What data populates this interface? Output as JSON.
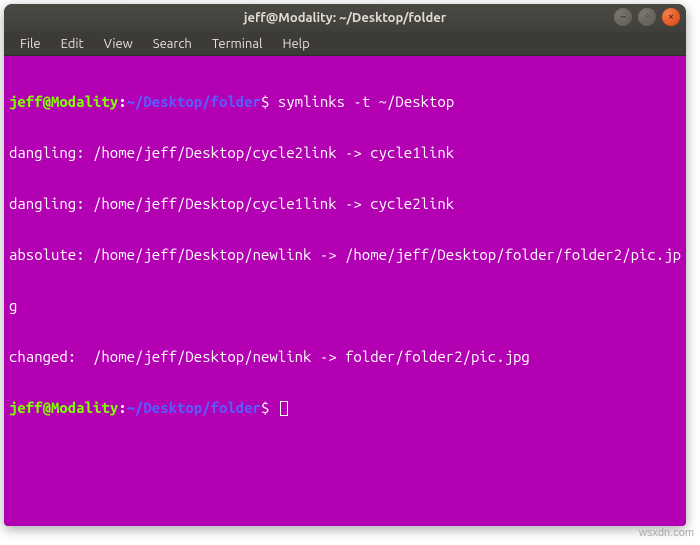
{
  "window": {
    "title": "jeff@Modality: ~/Desktop/folder"
  },
  "menubar": {
    "items": [
      {
        "label": "File"
      },
      {
        "label": "Edit"
      },
      {
        "label": "View"
      },
      {
        "label": "Search"
      },
      {
        "label": "Terminal"
      },
      {
        "label": "Help"
      }
    ]
  },
  "prompt1": {
    "user_host": "jeff@Modality",
    "colon": ":",
    "path": "~/Desktop/folder",
    "dollar": "$ ",
    "command": "symlinks -t ~/Desktop"
  },
  "output": {
    "l1": "dangling: /home/jeff/Desktop/cycle2link -> cycle1link",
    "l2": "dangling: /home/jeff/Desktop/cycle1link -> cycle2link",
    "l3": "absolute: /home/jeff/Desktop/newlink -> /home/jeff/Desktop/folder/folder2/pic.jp",
    "l4": "g",
    "l5": "changed:  /home/jeff/Desktop/newlink -> folder/folder2/pic.jpg"
  },
  "prompt2": {
    "user_host": "jeff@Modality",
    "colon": ":",
    "path": "~/Desktop/folder",
    "dollar": "$ "
  },
  "controls": {
    "min": "–",
    "max": "◦",
    "close": "×"
  },
  "watermark": "wsxdn.com"
}
